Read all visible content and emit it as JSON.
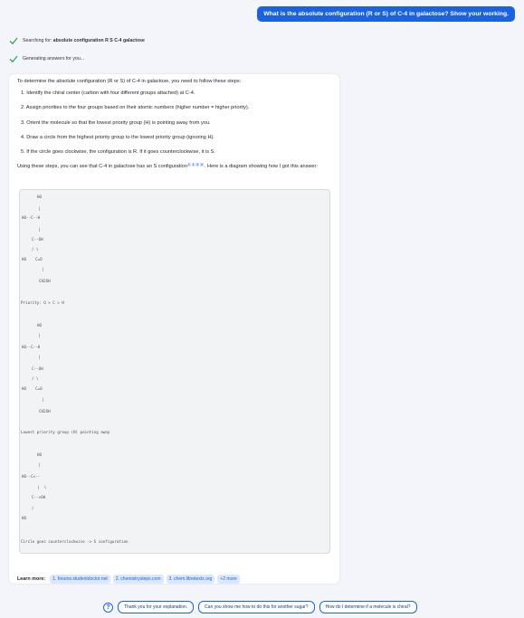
{
  "user_message": "What is the absolute configuration (R or S) of C-4 in galactose? Show your working.",
  "status": [
    {
      "prefix": "Searching for: ",
      "query": "absolute configuration R S C-4 galactose"
    },
    {
      "prefix": "Generating answers for you...",
      "query": ""
    }
  ],
  "answer": {
    "intro": "To determine the absolute configuration (R or S) of C-4 in galactose, you need to follow these steps:",
    "steps": [
      "1. Identify the chiral center (carbon with four different groups attached) at C-4.",
      "2. Assign priorities to the four groups based on their atomic numbers (higher number = higher priority).",
      "3. Orient the molecule so that the lowest priority group (H) is pointing away from you.",
      "4. Draw a circle from the highest priority group to the lowest priority group (ignoring H).",
      "5. If the circle goes clockwise, the configuration is R. If it goes counterclockwise, it is S."
    ],
    "summary_before": "Using these steps, you can see that C-4 in galactose has an S configuration",
    "citations": [
      "1",
      "2",
      "3",
      "4"
    ],
    "summary_after": ". Here is a diagram showing how I got this answer:",
    "code_lines": [
      "HO",
      "|",
      "HO--C--H",
      "|",
      "C--OH",
      "/ \\",
      "HO    C=O",
      "|",
      "CH2OH",
      "Priority: O > C > H",
      "HO",
      "|",
      "HO--C--H",
      "|",
      "C--OH",
      "/ \\",
      "HO    C=O",
      "|",
      "CH2OH",
      "Lowest priority group (H) pointing away",
      "HO",
      "|",
      "HO--C<--",
      "|  \\",
      "C-->OH",
      "/",
      "HO",
      "Circle goes counterclockwise -> S configuration"
    ]
  },
  "learn_more": {
    "label": "Learn more:",
    "links": [
      "1. forums.studentdoctor.net",
      "2. chemistrysteps.com",
      "3. chem.libretexts.org",
      "+2 more"
    ]
  },
  "suggestions": [
    "Thank you for your explanation.",
    "Can you show me how to do this for another sugar?",
    "How do I determine if a molecule is chiral?"
  ],
  "colors": {
    "accent": "#1b62e0",
    "check": "#2ea043"
  }
}
